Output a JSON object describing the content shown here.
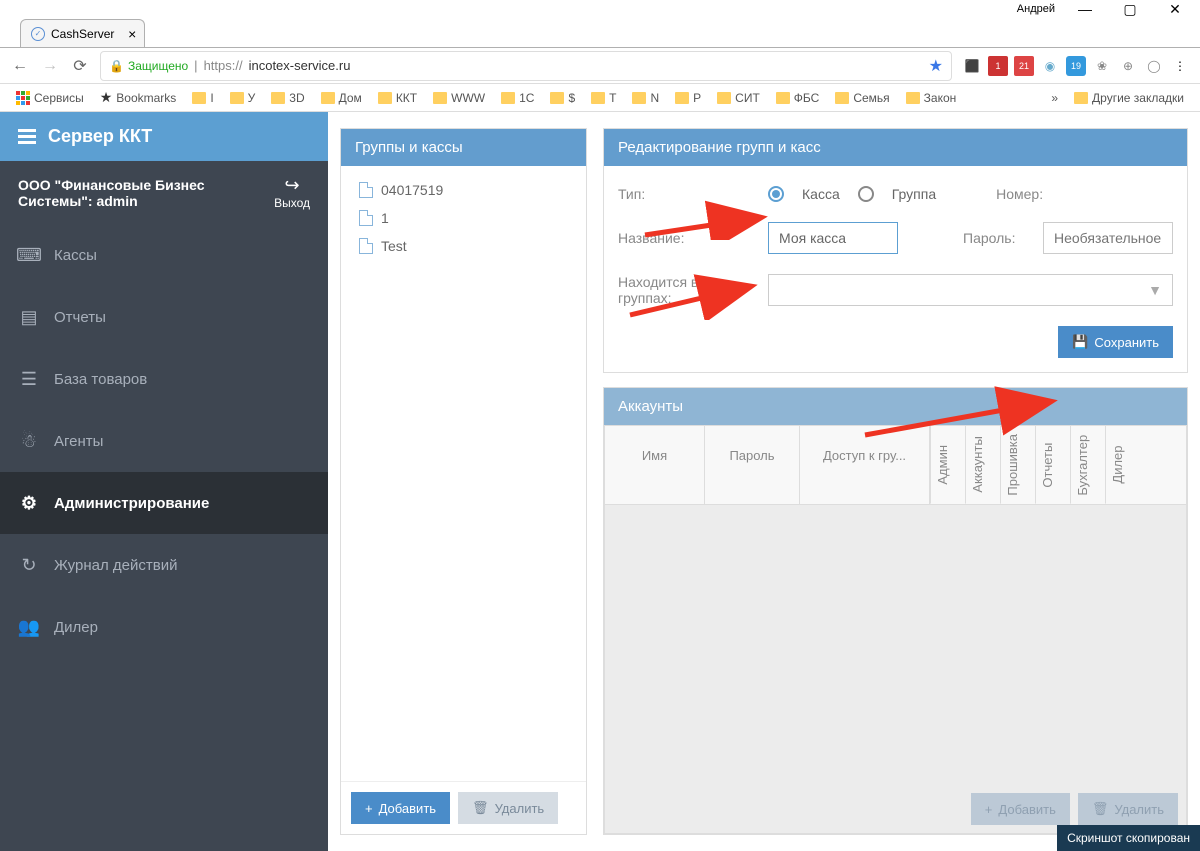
{
  "window": {
    "user": "Андрей"
  },
  "browser": {
    "tab_title": "CashServer",
    "secure_label": "Защищено",
    "url_protocol": "https://",
    "url_domain": "incotex-service.ru",
    "services": "Сервисы",
    "bookmarks_label": "Bookmarks",
    "other_bookmarks": "Другие закладки",
    "folders": [
      "I",
      "У",
      "3D",
      "Дом",
      "ККТ",
      "WWW",
      "1С",
      "$",
      "Т",
      "N",
      "Р",
      "СИТ",
      "ФБС",
      "Семья",
      "Закон"
    ]
  },
  "app": {
    "title": "Сервер ККТ",
    "org": "ООО \"Финансовые Бизнес Системы\": admin",
    "logout": "Выход",
    "nav": {
      "kassy": "Кассы",
      "otchety": "Отчеты",
      "baza": "База товаров",
      "agenty": "Агенты",
      "admin": "Администрирование",
      "zhurnal": "Журнал действий",
      "diler": "Дилер"
    }
  },
  "groups_panel": {
    "title": "Группы и кассы",
    "items": [
      "04017519",
      "1",
      "Test"
    ],
    "add": "Добавить",
    "delete": "Удалить"
  },
  "edit_panel": {
    "title": "Редактирование групп и касс",
    "type_label": "Тип:",
    "type_kassa": "Касса",
    "type_gruppa": "Группа",
    "number_label": "Номер:",
    "name_label": "Название:",
    "name_value": "Моя касса",
    "password_label": "Пароль:",
    "password_placeholder": "Необязательное",
    "groups_label": "Находится в группах:",
    "save": "Сохранить"
  },
  "accounts_panel": {
    "title": "Аккаунты",
    "cols": {
      "name": "Имя",
      "pass": "Пароль",
      "grp": "Доступ к гру...",
      "admin": "Админ",
      "accounts": "Аккаунты",
      "firmware": "Прошивка",
      "reports": "Отчеты",
      "buh": "Бухгалтер",
      "dealer": "Дилер"
    },
    "add": "Добавить",
    "delete": "Удалить"
  },
  "toast": "Скриншот скопирован"
}
